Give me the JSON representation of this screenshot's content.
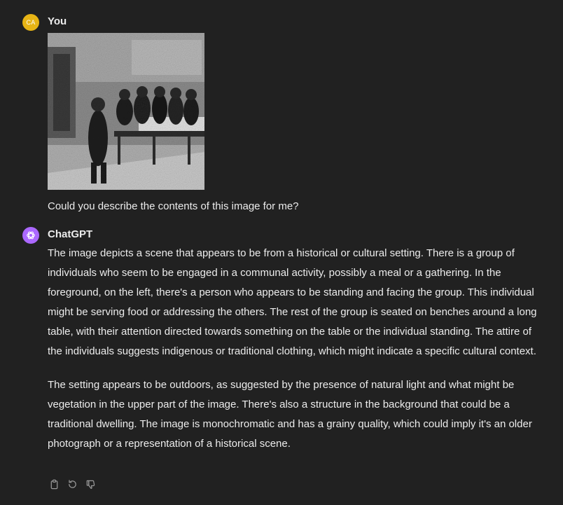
{
  "user_message": {
    "avatar_initials": "CA",
    "avatar_color": "#e7b415",
    "author": "You",
    "image_description_icon": "photo-attachment",
    "text": "Could you describe the contents of this image for me?"
  },
  "assistant_message": {
    "avatar_icon": "openai-logo-icon",
    "avatar_color": "#ab68ff",
    "author": "ChatGPT",
    "paragraphs": [
      "The image depicts a scene that appears to be from a historical or cultural setting. There is a group of individuals who seem to be engaged in a communal activity, possibly a meal or a gathering. In the foreground, on the left, there's a person who appears to be standing and facing the group. This individual might be serving food or addressing the others. The rest of the group is seated on benches around a long table, with their attention directed towards something on the table or the individual standing. The attire of the individuals suggests indigenous or traditional clothing, which might indicate a specific cultural context.",
      "The setting appears to be outdoors, as suggested by the presence of natural light and what might be vegetation in the upper part of the image. There's also a structure in the background that could be a traditional dwelling. The image is monochromatic and has a grainy quality, which could imply it's an older photograph or a representation of a historical scene."
    ],
    "actions": [
      "copy-icon",
      "regenerate-icon",
      "thumbs-down-icon"
    ]
  },
  "colors": {
    "background": "#212121",
    "text": "#ececec",
    "icon": "#9b9b9b"
  }
}
